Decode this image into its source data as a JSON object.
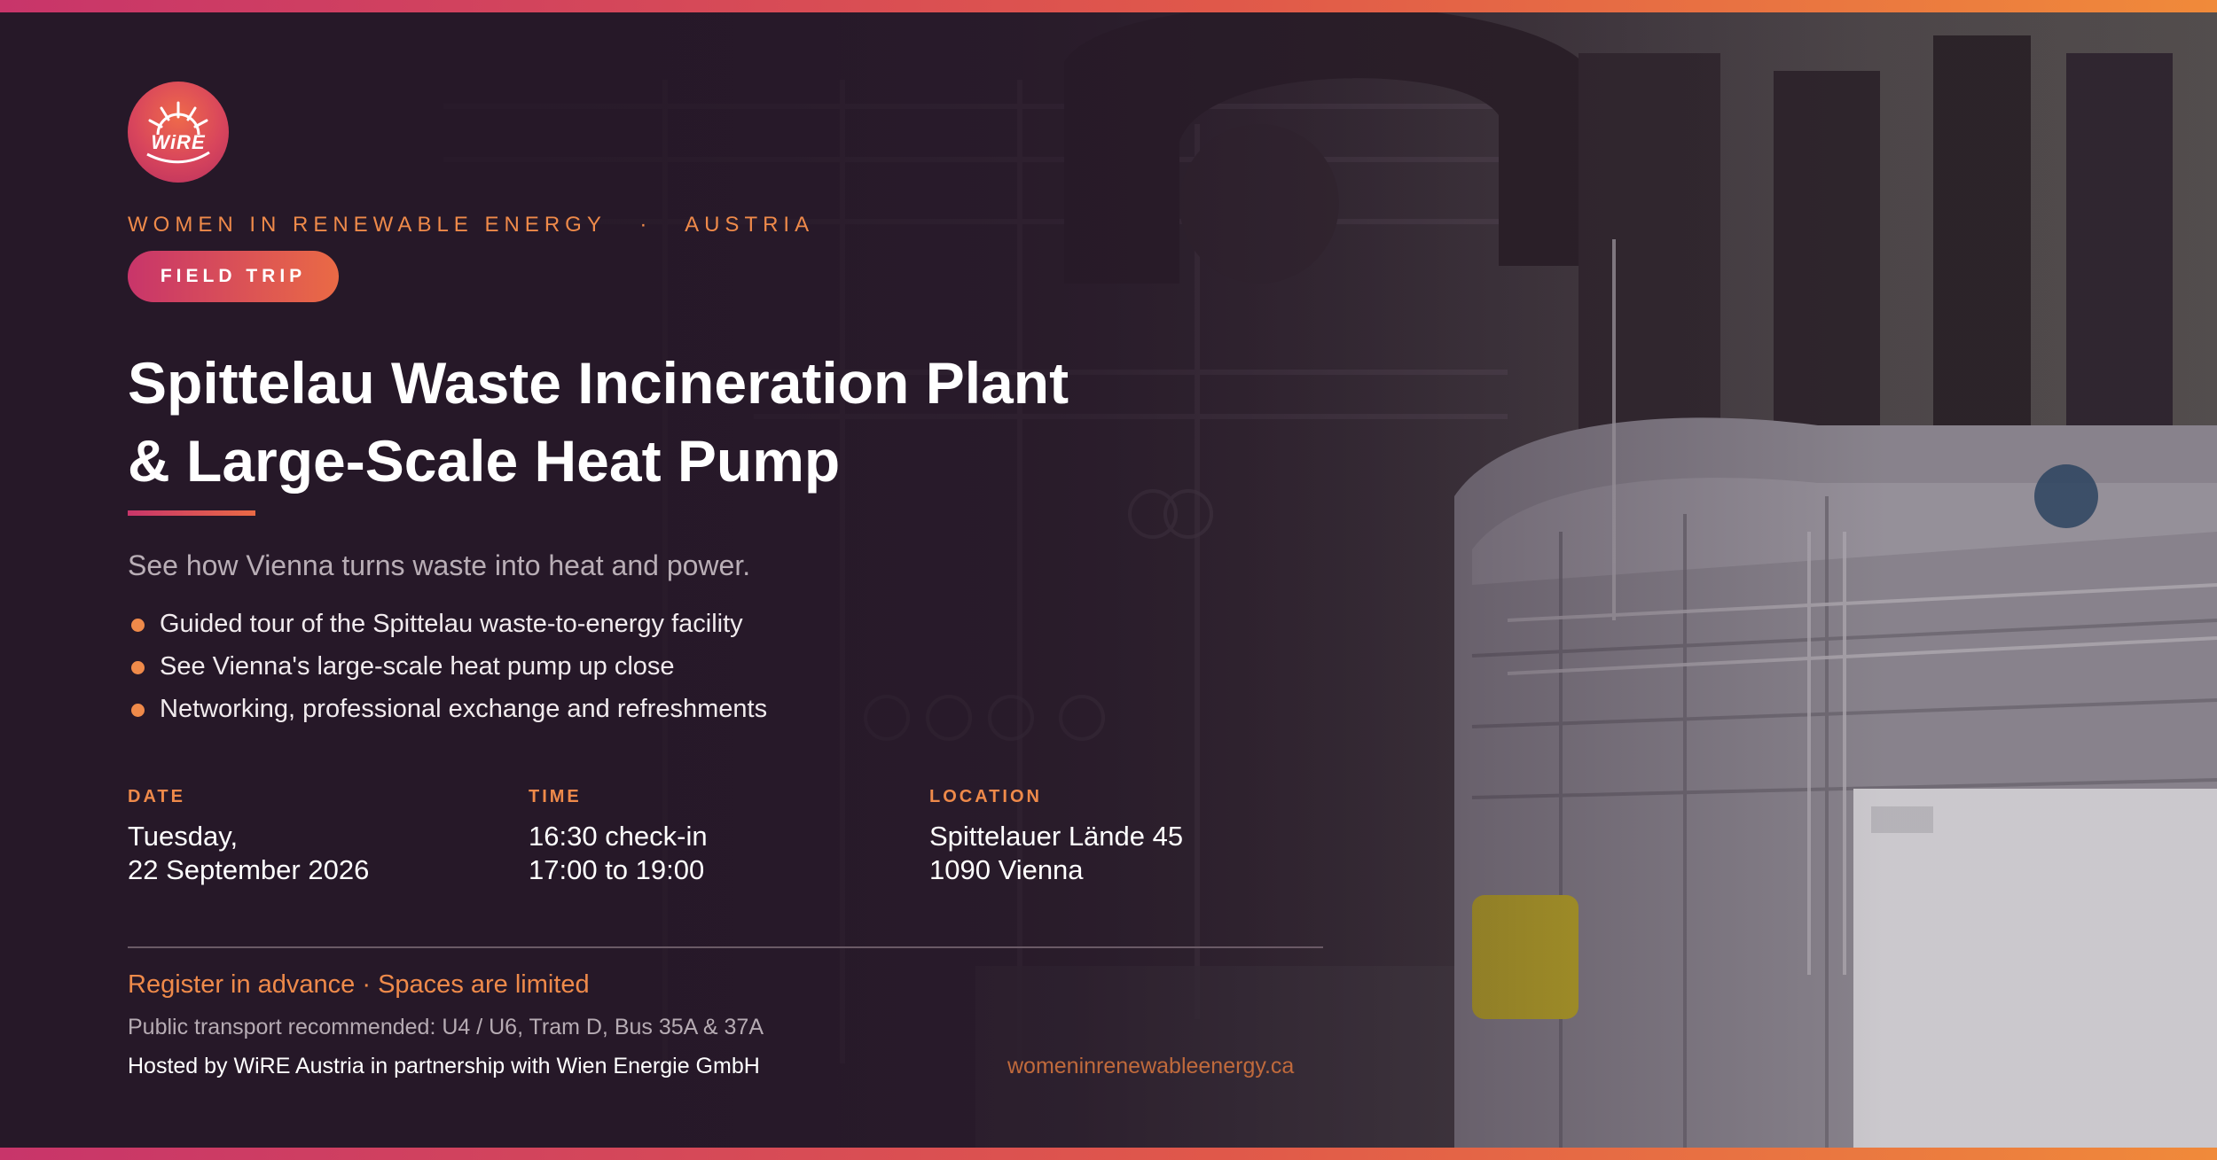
{
  "brand": {
    "logo_text": "WiRE",
    "organization": "WOMEN IN RENEWABLE ENERGY",
    "separator": "·",
    "region": "AUSTRIA",
    "accent_color": "#ef8a4a",
    "brand_pink": "#c8356a"
  },
  "event": {
    "badge": "FIELD TRIP",
    "title_line1": "Spittelau Waste Incineration Plant",
    "title_line2": "& Large-Scale Heat Pump",
    "tagline": "See how Vienna turns waste into heat and power.",
    "highlights": [
      "Guided tour of the Spittelau waste-to-energy facility",
      "See Vienna's large-scale heat pump up close",
      "Networking, professional exchange and refreshments"
    ]
  },
  "details": {
    "date": {
      "label": "DATE",
      "line1": "Tuesday,",
      "line2": "22 September 2026"
    },
    "time": {
      "label": "TIME",
      "line1": "16:30 check-in",
      "line2": "17:00 to 19:00"
    },
    "location": {
      "label": "LOCATION",
      "line1": "Spittelauer Lände 45",
      "line2": "1090 Vienna"
    }
  },
  "footer": {
    "register": "Register in advance · Spaces are limited",
    "transport": "Public transport recommended: U4 / U6, Tram D, Bus 35A & 37A",
    "hosted_by": "Hosted by WiRE Austria in partnership with Wien Energie GmbH",
    "website": "womeninrenewableenergy.ca"
  }
}
